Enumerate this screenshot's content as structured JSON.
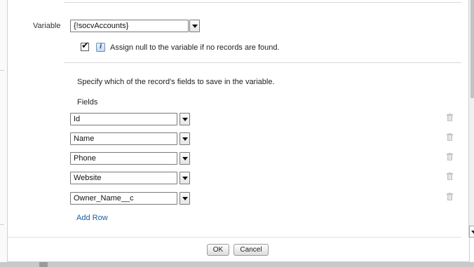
{
  "variable": {
    "label": "Variable",
    "required_marker": "*",
    "value": "{!socvAccounts}"
  },
  "assign_null": {
    "checked": true,
    "check_glyph": "✔",
    "info_icon": "info-icon",
    "info_glyph": "i",
    "label": "Assign null to the variable if no records are found."
  },
  "fields_section": {
    "instruction": "Specify which of the record's fields to save in the variable.",
    "heading": "Fields",
    "rows": [
      {
        "value": "Id",
        "delete_icon": "trash-icon"
      },
      {
        "value": "Name",
        "delete_icon": "trash-icon"
      },
      {
        "value": "Phone",
        "delete_icon": "trash-icon"
      },
      {
        "value": "Website",
        "delete_icon": "trash-icon"
      },
      {
        "value": "Owner_Name__c",
        "delete_icon": "trash-icon"
      }
    ],
    "add_row_label": "Add Row"
  },
  "footer": {
    "ok_label": "OK",
    "cancel_label": "Cancel"
  },
  "colors": {
    "link": "#1a5da0",
    "required": "#c23934"
  }
}
